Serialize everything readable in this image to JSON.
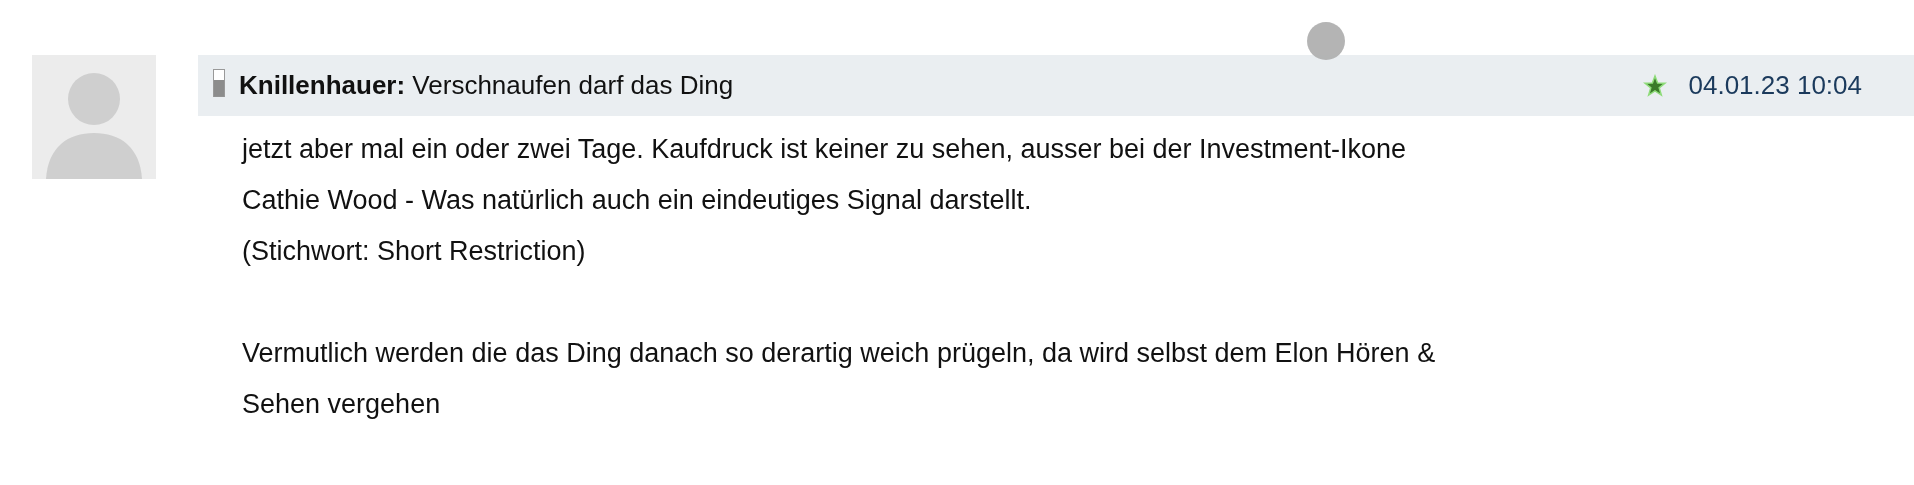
{
  "post": {
    "author": "Knillenhauer:",
    "title": "Verschnaufen darf das Ding",
    "timestamp": "04.01.23 10:04",
    "paragraphs": [
      "jetzt aber mal ein oder zwei Tage. Kaufdruck ist keiner zu sehen, ausser bei der Investment-Ikone\nCathie Wood - Was natürlich auch ein eindeutiges Signal darstellt.\n(Stichwort: Short Restriction)",
      "Vermutlich werden die das Ding danach so derartig weich prügeln, da wird selbst dem Elon Hören &\nSehen vergehen"
    ]
  }
}
